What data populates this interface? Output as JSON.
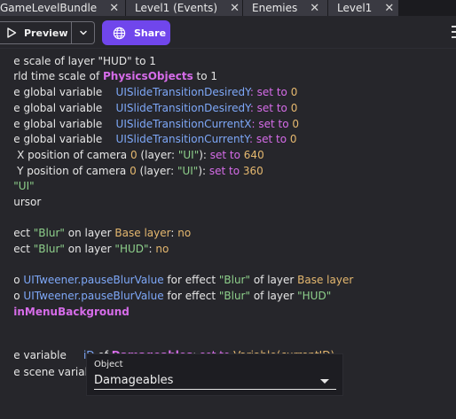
{
  "tabs": [
    {
      "label": "GameLevelBundle",
      "close": "✕"
    },
    {
      "label": "Level1 (Events)",
      "close": "✕"
    },
    {
      "label": "Enemies",
      "close": "✕"
    },
    {
      "label": "Level1",
      "close": "✕"
    }
  ],
  "toolbar": {
    "preview_label": "Preview",
    "share_label": "Share",
    "preview_icon": "play-outline-icon",
    "dropdown_icon": "chevron-down-icon",
    "share_icon": "globe-icon",
    "share_color": "#7046ec"
  },
  "lines": {
    "l0": {
      "t1": "e scale of layer \"HUD\" to 1"
    },
    "l1": {
      "t1": "rld time scale of ",
      "t2": "PhysicsObjects",
      "t3": " to ",
      "t4": "1"
    },
    "l2": {
      "t1": "e global variable    ",
      "t2": "UISlideTransitionDesiredY",
      "t3": ": set to ",
      "t4": "0"
    },
    "l3": {
      "t1": "e global variable    ",
      "t2": "UISlideTransitionDesiredY",
      "t3": ": set to ",
      "t4": "0"
    },
    "l4": {
      "t1": "e global variable    ",
      "t2": "UISlideTransitionCurrentX",
      "t3": ": set to ",
      "t4": "0"
    },
    "l5": {
      "t1": "e global variable    ",
      "t2": "UISlideTransitionCurrentY",
      "t3": ": set to ",
      "t4": "0"
    },
    "l6": {
      "t1": " X position of camera ",
      "t2": "0",
      "t3": " (layer: ",
      "t4": "\"UI\"",
      "t5": "): ",
      "t6": "set to ",
      "t7": "640"
    },
    "l7": {
      "t1": " Y position of camera ",
      "t2": "0",
      "t3": " (layer: ",
      "t4": "\"UI\"",
      "t5": "): ",
      "t6": "set to ",
      "t7": "360"
    },
    "l8": {
      "t1": "\"UI\""
    },
    "l9": {
      "t1": "ursor"
    },
    "l10": {
      "t1": "ect ",
      "t2": "\"Blur\"",
      "t3": " on layer ",
      "t4": "Base layer",
      "t5": ": ",
      "t6": "no"
    },
    "l11": {
      "t1": "ect ",
      "t2": "\"Blur\"",
      "t3": " on layer ",
      "t4": "\"HUD\"",
      "t5": ": ",
      "t6": "no"
    },
    "l12": {
      "t1": "o ",
      "t2": "UITweener.pauseBlurValue",
      "t3": " for effect ",
      "t4": "\"Blur\"",
      "t5": " of layer ",
      "t6": "Base layer"
    },
    "l13": {
      "t1": "o ",
      "t2": "UITweener.pauseBlurValue",
      "t3": " for effect ",
      "t4": "\"Blur\"",
      "t5": " of layer ",
      "t6": "\"HUD\""
    },
    "l14": {
      "t1": "inMenuBackground"
    },
    "l15": {
      "t1": "e variable     ",
      "t2": "iD",
      "t3": " of ",
      "t4": "Damageables",
      "t5": ": ",
      "t6": "set to ",
      "t7": "Variable(currentID)"
    },
    "l16": {
      "t1": "e scene variable"
    }
  },
  "popup": {
    "label": "Object",
    "value": "Damageables",
    "caret_icon": "caret-down-icon"
  }
}
